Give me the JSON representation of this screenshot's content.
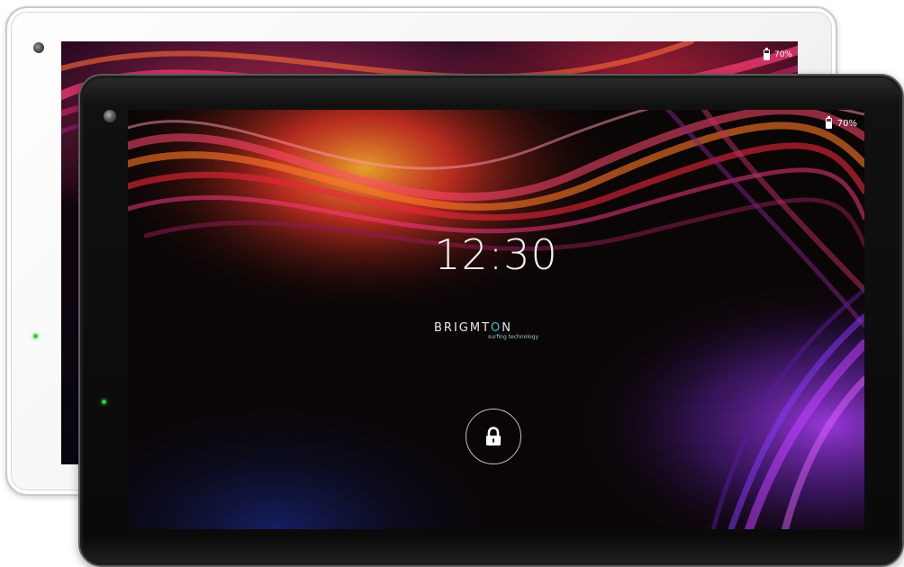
{
  "back_tablet": {
    "status": {
      "battery_text": "70%",
      "battery_icon": "battery-icon"
    },
    "bezel_color": "#ffffff"
  },
  "front_tablet": {
    "status": {
      "battery_text": "70%",
      "battery_icon": "battery-icon",
      "battery_level": 0.7
    },
    "lockscreen": {
      "time": "12:30",
      "brand_prefix": "BRIGMT",
      "brand_o": "O",
      "brand_suffix": "N",
      "brand_tagline": "surfing technology",
      "unlock_icon": "lock-icon"
    },
    "bezel_color": "#0a0a0a",
    "accent_color": "#2fc4d6",
    "led_color": "#2ad13a"
  }
}
